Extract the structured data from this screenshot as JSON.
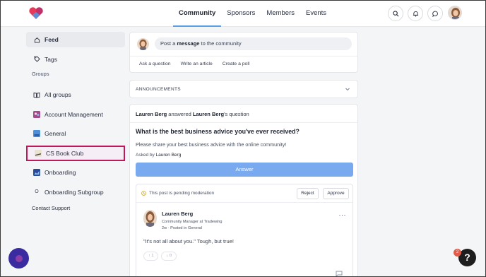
{
  "header": {
    "nav": [
      {
        "label": "Community",
        "active": true
      },
      {
        "label": "Sponsors",
        "active": false
      },
      {
        "label": "Members",
        "active": false
      },
      {
        "label": "Events",
        "active": false
      }
    ],
    "icons": [
      "search-icon",
      "bell-icon",
      "chat-icon"
    ],
    "accent": "#5aa0e8"
  },
  "sidebar": {
    "feed": "Feed",
    "tags": "Tags",
    "groups_heading": "Groups",
    "items": [
      {
        "label": "All groups"
      },
      {
        "label": "Account Management"
      },
      {
        "label": "General"
      },
      {
        "label": "CS Book Club"
      },
      {
        "label": "Onboarding"
      },
      {
        "label": "Onboarding Subgroup",
        "badge": "O"
      }
    ],
    "contact": "Contact Support",
    "highlight_color": "#c0185a"
  },
  "composer": {
    "prefix": "Post a ",
    "bold": "message",
    "suffix": " to the community",
    "actions": [
      "Ask a question",
      "Write an article",
      "Create a poll"
    ]
  },
  "announcements": {
    "label": "ANNOUNCEMENTS"
  },
  "post": {
    "actor": "Lauren Berg",
    "verb": " answered ",
    "target": "Lauren Berg",
    "suffix": "'s question",
    "question": "What is the best business advice you've ever received?",
    "description": "Please share your best business advice with the online community!",
    "asked_prefix": "Asked by ",
    "asked_by": "Lauren Berg",
    "answer_label": "Answer",
    "answer_color": "#79aaf0",
    "moderation": {
      "text": "This post is pending moderation",
      "reject": "Reject",
      "approve": "Approve"
    },
    "reply": {
      "name": "Lauren Berg",
      "role": "Community Manager at Tradewing",
      "when": "2w · Posted in General",
      "more": "···",
      "text": "\"It's not all about you.\" Tough, but true!",
      "upvotes": "1",
      "downvotes": "0"
    }
  },
  "help": {
    "label": "?",
    "badge": "2"
  }
}
